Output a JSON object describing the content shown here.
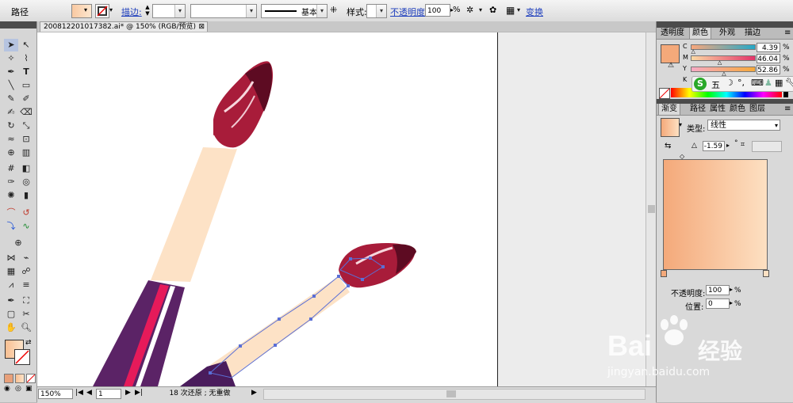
{
  "control_bar": {
    "object_type": "路径",
    "stroke_link": "描边:",
    "stroke_profile": "基本",
    "style_label": "样式:",
    "opacity_link": "不透明度:",
    "opacity_value": "100",
    "opacity_unit": "%",
    "transform_link": "变换"
  },
  "document": {
    "tab_title": "20081220101738​2.ai* @ 150% (RGB/预览)",
    "close_icon": "⊠"
  },
  "status_bar": {
    "zoom": "150%",
    "artboard_number": "1",
    "status_text": "18 次还原 ; 无重做"
  },
  "color_panel": {
    "tabs": [
      "透明度",
      "颜色",
      "外观",
      "描边"
    ],
    "active_tab": "颜色",
    "fill_color": "#f4a97a",
    "channels": [
      {
        "name": "C",
        "value": "4.39",
        "unit": "%"
      },
      {
        "name": "M",
        "value": "46.04",
        "unit": "%"
      },
      {
        "name": "Y",
        "value": "52.86",
        "unit": "%"
      },
      {
        "name": "K",
        "value": "",
        "unit": ""
      }
    ],
    "ime_toolbar": {
      "logo": "S",
      "mode": "五"
    }
  },
  "gradient_panel": {
    "tabs": [
      "渐变",
      "路径",
      "属性",
      "颜色",
      "图层"
    ],
    "active_tab": "渐变",
    "type_label": "类型:",
    "type_value": "线性",
    "angle_value": "-1.59",
    "angle_unit": "°",
    "gradient_start": "#f4a97a",
    "gradient_end": "#fde0c2",
    "opacity_label": "不透明度:",
    "opacity_value": "100",
    "opacity_unit": "%",
    "position_label": "位置:",
    "position_value": "0",
    "position_unit": "%"
  },
  "watermark": {
    "brand": "Bai",
    "brand_suffix": "经验",
    "url": "jingyan.baidu.com"
  }
}
